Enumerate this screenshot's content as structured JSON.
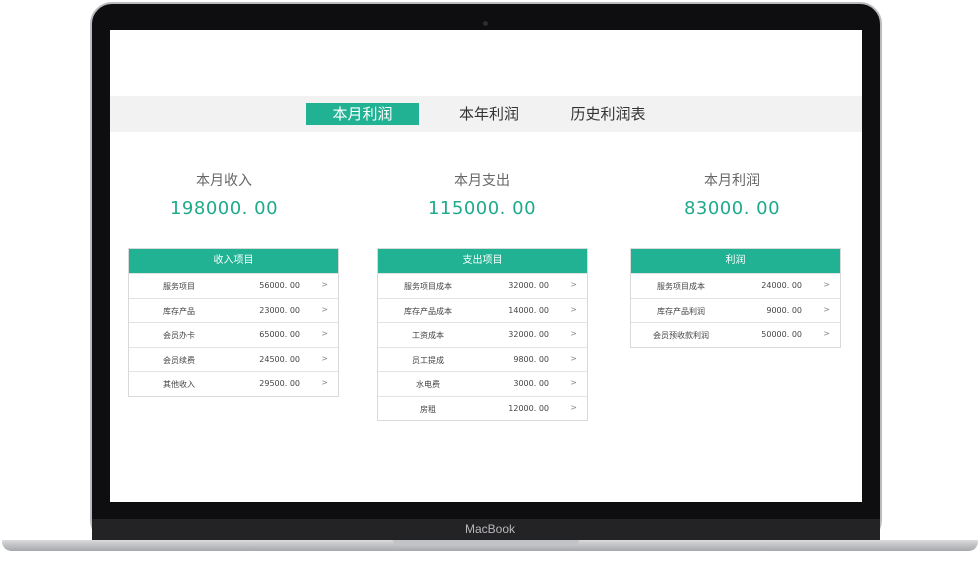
{
  "device": {
    "brand": "MacBook"
  },
  "tabs": [
    {
      "label": "本月利润",
      "active": true
    },
    {
      "label": "本年利润",
      "active": false
    },
    {
      "label": "历史利润表",
      "active": false
    }
  ],
  "summary": {
    "income": {
      "label": "本月收入",
      "value": "198000. 00"
    },
    "expense": {
      "label": "本月支出",
      "value": "115000. 00"
    },
    "profit": {
      "label": "本月利润",
      "value": "83000. 00"
    }
  },
  "panels": {
    "income": {
      "title": "收入项目",
      "rows": [
        {
          "name": "服务项目",
          "value": "56000. 00",
          "arrow": ">"
        },
        {
          "name": "库存产品",
          "value": "23000. 00",
          "arrow": ">"
        },
        {
          "name": "会员办卡",
          "value": "65000. 00",
          "arrow": ">"
        },
        {
          "name": "会员续费",
          "value": "24500. 00",
          "arrow": ">"
        },
        {
          "name": "其他收入",
          "value": "29500. 00",
          "arrow": ">"
        }
      ]
    },
    "expense": {
      "title": "支出项目",
      "rows": [
        {
          "name": "服务项目成本",
          "value": "32000. 00",
          "arrow": ">"
        },
        {
          "name": "库存产品成本",
          "value": "14000. 00",
          "arrow": ">"
        },
        {
          "name": "工资成本",
          "value": "32000. 00",
          "arrow": ">"
        },
        {
          "name": "员工提成",
          "value": "9800. 00",
          "arrow": ">"
        },
        {
          "name": "水电费",
          "value": "3000. 00",
          "arrow": ">"
        },
        {
          "name": "房租",
          "value": "12000. 00",
          "arrow": ">"
        }
      ]
    },
    "profit": {
      "title": "利润",
      "rows": [
        {
          "name": "服务项目成本",
          "value": "24000. 00",
          "arrow": ">"
        },
        {
          "name": "库存产品利润",
          "value": "9000. 00",
          "arrow": ">"
        },
        {
          "name": "会员预收款利润",
          "value": "50000. 00",
          "arrow": ">"
        }
      ]
    }
  },
  "colors": {
    "accent": "#20b293",
    "value_text": "#1faa8c",
    "tabbar_bg": "#f2f2f2"
  }
}
